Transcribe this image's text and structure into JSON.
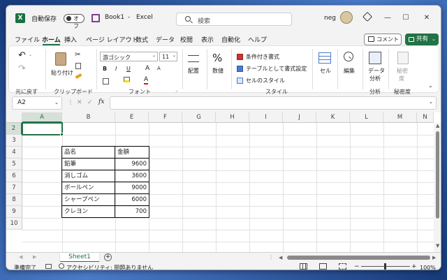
{
  "titlebar": {
    "autosave_label": "自動保存",
    "toggle_state": "オフ",
    "file_name": "Book1",
    "separator": "-",
    "app_name": "Excel",
    "search_placeholder": "検索",
    "user": "neg",
    "min": "—",
    "max": "☐",
    "close": "✕"
  },
  "menu": {
    "items": [
      "ファイル",
      "ホーム",
      "挿入",
      "ページ レイアウト",
      "数式",
      "データ",
      "校閲",
      "表示",
      "自動化",
      "ヘルプ"
    ],
    "active": "ホーム",
    "comment_label": "コメント",
    "share_label": "共有"
  },
  "ribbon": {
    "undo_group": "元に戻す",
    "clipboard": {
      "paste": "貼り付け",
      "group": "クリップボード"
    },
    "font": {
      "name": "游ゴシック",
      "size": "11",
      "bold": "B",
      "italic": "I",
      "underline": "U",
      "group": "フォント",
      "grow": "A",
      "shrink": "A"
    },
    "align": {
      "label": "配置"
    },
    "number": {
      "label": "数値",
      "icon_text": "%"
    },
    "styles": {
      "cond": "条件付き書式",
      "table": "テーブルとして書式設定",
      "cell": "セルのスタイル",
      "group": "スタイル"
    },
    "cells": {
      "label": "セル"
    },
    "edit": {
      "label": "編集"
    },
    "analysis": {
      "label1": "データ",
      "label2": "分析",
      "group": "分析"
    },
    "sensitivity": {
      "label1": "秘密",
      "label2": "度",
      "group": "秘密度"
    }
  },
  "formula": {
    "name_box": "A2",
    "cancel": "✕",
    "enter": "✓",
    "fx": "fx",
    "value": ""
  },
  "grid": {
    "columns": [
      "A",
      "B",
      "E",
      "F",
      "G",
      "H",
      "I",
      "J",
      "K",
      "L",
      "M",
      "N"
    ],
    "rows": [
      "2",
      "3",
      "4",
      "5",
      "6",
      "7",
      "8",
      "9",
      "10"
    ],
    "table": {
      "header": [
        "品名",
        "金額"
      ],
      "rows": [
        [
          "鉛筆",
          "9600"
        ],
        [
          "消しゴム",
          "3600"
        ],
        [
          "ボールペン",
          "9000"
        ],
        [
          "シャープペン",
          "6000"
        ],
        [
          "クレヨン",
          "700"
        ]
      ]
    }
  },
  "sheet": {
    "tab": "Sheet1",
    "add": "+"
  },
  "status": {
    "ready": "準備完了",
    "accessibility": "アクセシビリティ: 問題ありません",
    "zoom": "100%",
    "minus": "−",
    "plus": "+"
  }
}
